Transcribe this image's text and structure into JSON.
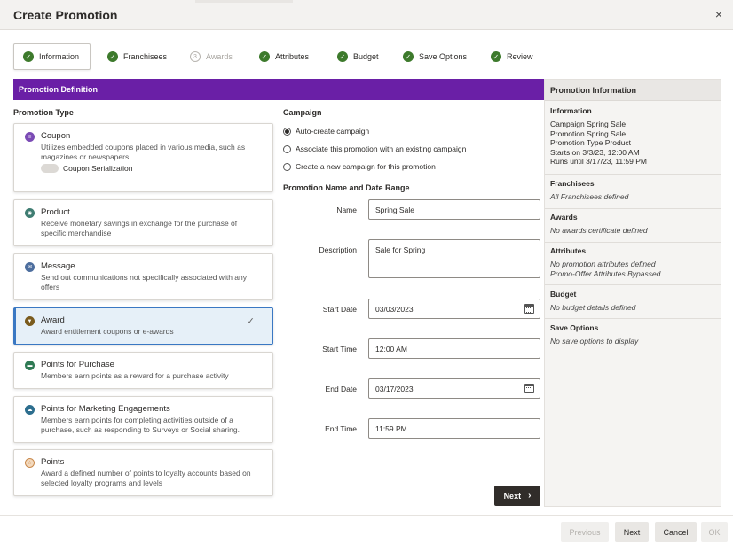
{
  "dialog": {
    "title": "Create Promotion",
    "close_glyph": "×"
  },
  "train": {
    "steps": [
      {
        "label": "Information",
        "state": "active"
      },
      {
        "label": "Franchisees",
        "state": "complete"
      },
      {
        "label": "Awards",
        "state": "disabled",
        "number": "3"
      },
      {
        "label": "Attributes",
        "state": "complete"
      },
      {
        "label": "Budget",
        "state": "complete"
      },
      {
        "label": "Save Options",
        "state": "complete"
      },
      {
        "label": "Review",
        "state": "complete"
      }
    ],
    "check_glyph": "✓"
  },
  "definition_bar": "Promotion Definition",
  "promotion_type": {
    "label": "Promotion Type",
    "items": [
      {
        "title": "Coupon",
        "desc": "Utilizes embedded coupons placed in various media, such as magazines or newspapers",
        "icon": "coupon-icon",
        "color": "#7b4bb5",
        "toggle_label": "Coupon Serialization"
      },
      {
        "title": "Product",
        "desc": "Receive monetary savings in exchange for the purchase of specific merchandise",
        "icon": "product-icon",
        "color": "#3f7d72"
      },
      {
        "title": "Message",
        "desc": "Send out communications not specifically associated with any offers",
        "icon": "message-icon",
        "color": "#4d6e9e"
      },
      {
        "title": "Award",
        "desc": "Award entitlement coupons or e-awards",
        "icon": "award-icon",
        "color": "#7a5b1d",
        "selected": true
      },
      {
        "title": "Points for Purchase",
        "desc": "Members earn points as a reward for a purchase activity",
        "icon": "points-purchase-icon",
        "color": "#2f7a54"
      },
      {
        "title": "Points for Marketing Engagements",
        "desc": "Members earn points for completing activities outside of a purchase, such as responding to Surveys or Social sharing.",
        "icon": "points-engagement-icon",
        "color": "#2d6e8e"
      },
      {
        "title": "Points",
        "desc": "Award a defined number of points to loyalty accounts based on selected loyalty programs and levels",
        "icon": "points-icon",
        "color": "#c98a4d"
      }
    ]
  },
  "campaign": {
    "label": "Campaign",
    "options": [
      {
        "label": "Auto-create campaign",
        "selected": true
      },
      {
        "label": "Associate this promotion with an existing campaign",
        "selected": false
      },
      {
        "label": "Create a new campaign for this promotion",
        "selected": false
      }
    ]
  },
  "name_date": {
    "label": "Promotion Name and Date Range",
    "name_label": "Name",
    "name_value": "Spring Sale",
    "description_label": "Description",
    "description_value": "Sale for Spring",
    "start_date_label": "Start Date",
    "start_date_value": "03/03/2023",
    "start_time_label": "Start Time",
    "start_time_value": "12:00 AM",
    "end_date_label": "End Date",
    "end_date_value": "03/17/2023",
    "end_time_label": "End Time",
    "end_time_value": "11:59 PM"
  },
  "next_inline": {
    "label": "Next",
    "chevron": "›"
  },
  "info_panel": {
    "title": "Promotion Information",
    "information": {
      "title": "Information",
      "lines": [
        "Campaign Spring Sale",
        "Promotion Spring Sale",
        "Promotion Type Product",
        "Starts on 3/3/23, 12:00 AM",
        "Runs until 3/17/23, 11:59 PM"
      ]
    },
    "franchisees": {
      "title": "Franchisees",
      "text": "All Franchisees defined"
    },
    "awards": {
      "title": "Awards",
      "text": "No awards certificate defined"
    },
    "attributes": {
      "title": "Attributes",
      "text": "No promotion attributes defined",
      "text2": "Promo-Offer Attributes Bypassed"
    },
    "budget": {
      "title": "Budget",
      "text": "No budget details defined"
    },
    "save_options": {
      "title": "Save Options",
      "text": "No save options to display"
    }
  },
  "footer": {
    "previous": "Previous",
    "next": "Next",
    "cancel": "Cancel",
    "ok": "OK"
  },
  "icons": {
    "coupon": "≡",
    "product": "◉",
    "message": "✉",
    "award": "▼",
    "points_purchase": "▬",
    "points_engagement": "☁",
    "points": "☆"
  }
}
